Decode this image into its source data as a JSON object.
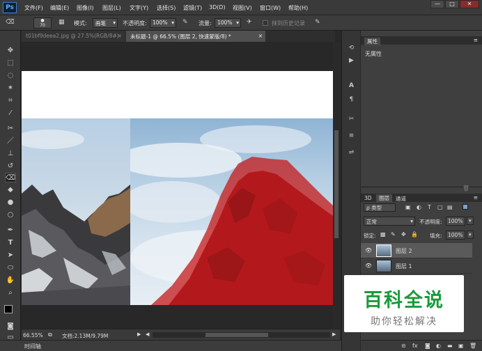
{
  "app": {
    "logo": "Ps"
  },
  "menu": [
    "文件(F)",
    "编辑(E)",
    "图像(I)",
    "图层(L)",
    "文字(Y)",
    "选择(S)",
    "滤镜(T)",
    "3D(D)",
    "视图(V)",
    "窗口(W)",
    "帮助(H)"
  ],
  "window_controls": {
    "minimize": "—",
    "restore": "□",
    "close": "✕"
  },
  "options": {
    "brush_size": "70",
    "mode_label": "模式:",
    "mode_value": "画笔",
    "opacity_label": "不透明度:",
    "opacity_value": "100%",
    "flow_label": "流量:",
    "flow_value": "100%",
    "history_label": "抹到历史记录"
  },
  "tabs": [
    {
      "label": "t01bf9deea2.jpg @ 27.5%(RGB/8#)",
      "close": "×"
    },
    {
      "label": "未标题-1 @ 66.5% (图层 2, 快速蒙版/8) *",
      "close": "×"
    }
  ],
  "status": {
    "zoom": "66.55%",
    "doc": "文档:2.13M/9.79M"
  },
  "timeline": {
    "label": "时间轴"
  },
  "properties": {
    "title": "属性",
    "content": "无属性"
  },
  "layers_panel": {
    "tabs": [
      "3D",
      "图层",
      "通道"
    ],
    "filter_label": "ρ 类型",
    "blend_mode": "正常",
    "opacity_label": "不透明度:",
    "opacity_value": "100%",
    "lock_label": "锁定:",
    "fill_label": "填充:",
    "fill_value": "100%",
    "layers": [
      {
        "name": "图层 2"
      },
      {
        "name": "图层 1"
      }
    ]
  },
  "watermark": {
    "title": "百科全说",
    "subtitle": "助你轻松解决"
  },
  "colors": {
    "accent_red": "#c41a1a",
    "ps_blue": "#5fb0ff",
    "watermark_green": "#1a9a3a"
  }
}
